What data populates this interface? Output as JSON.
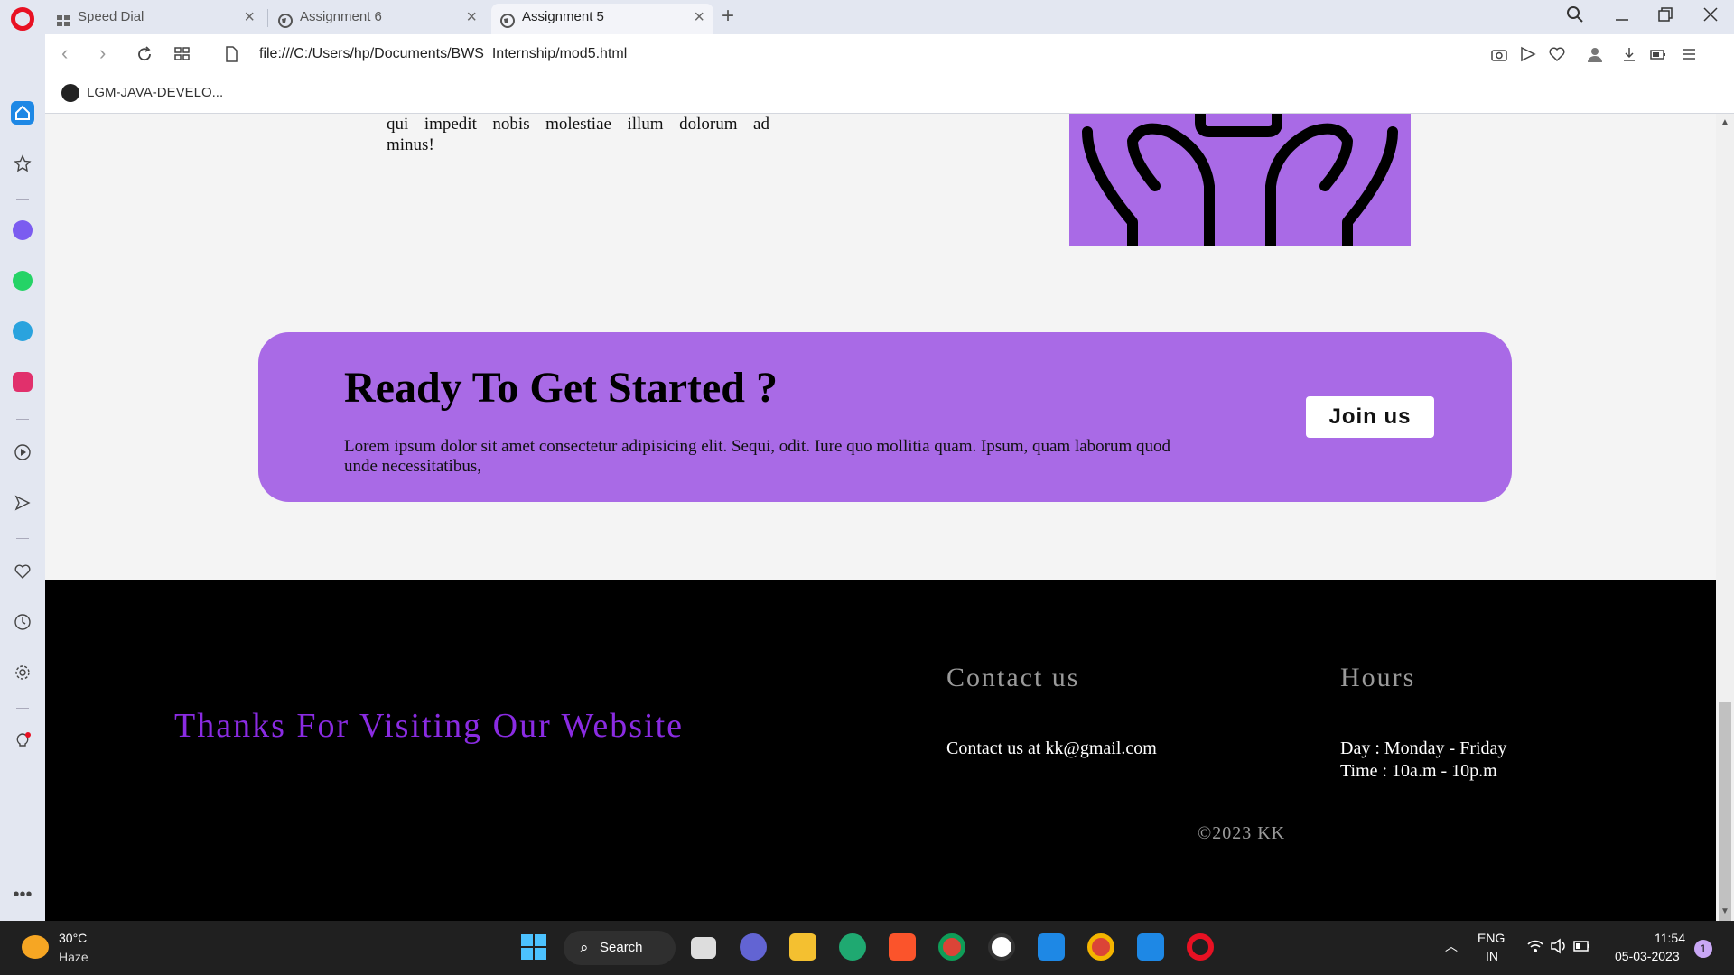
{
  "browser": {
    "tabs": [
      {
        "label": "Speed Dial",
        "active": false
      },
      {
        "label": "Assignment 6",
        "active": false
      },
      {
        "label": "Assignment 5",
        "active": true
      }
    ],
    "url": "file:///C:/Users/hp/Documents/BWS_Internship/mod5.html",
    "bookmark": "LGM-JAVA-DEVELO..."
  },
  "page": {
    "para_lines": [
      "qui impedit nobis molestiae illum dolorum ad",
      "minus!"
    ],
    "cta": {
      "title": "Ready To Get Started ?",
      "text": "Lorem ipsum dolor sit amet consectetur adipisicing elit. Sequi, odit. Iure quo mollitia quam. Ipsum, quam laborum quod unde necessitatibus,",
      "button": "Join us"
    },
    "footer": {
      "thanks": "Thanks For Visiting Our Website",
      "contact_heading": "Contact us",
      "contact_text": "Contact us at kk@gmail.com",
      "hours_heading": "Hours",
      "days": "Day : Monday - Friday",
      "time": "Time : 10a.m - 10p.m",
      "copyright": "©2023 KK"
    }
  },
  "taskbar": {
    "temp": "30°C",
    "weather": "Haze",
    "search": "Search",
    "lang_top": "ENG",
    "lang_bottom": "IN",
    "time": "11:54",
    "date": "05-03-2023",
    "notifications": "1"
  },
  "colors": {
    "accent_purple": "#a96ae6",
    "thanks_purple": "#8a2be2",
    "footer_bg": "#000000"
  }
}
